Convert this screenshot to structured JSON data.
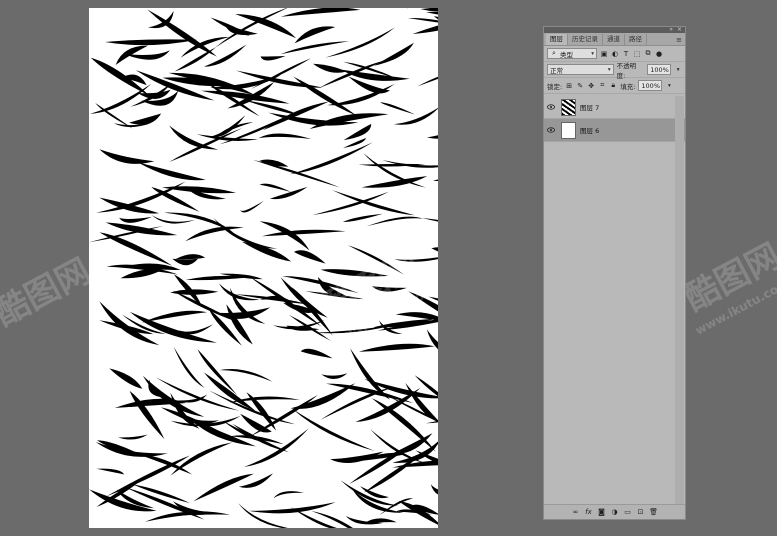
{
  "canvas": {
    "watermark_text": "酷图网",
    "watermark_url": "www.ikutu.com"
  },
  "panel": {
    "tabs": [
      {
        "label": "图层",
        "active": true
      },
      {
        "label": "历史记录",
        "active": false
      },
      {
        "label": "通道",
        "active": false
      },
      {
        "label": "路径",
        "active": false
      }
    ],
    "filter": {
      "label": "类型"
    },
    "blend_mode": "正常",
    "opacity_label": "不透明度:",
    "opacity_value": "100%",
    "lock_label": "锁定:",
    "fill_label": "填充:",
    "fill_value": "100%",
    "layers": [
      {
        "name": "图层 7",
        "selected": false,
        "thumb": "pattern"
      },
      {
        "name": "图层 6",
        "selected": true,
        "thumb": "white"
      }
    ],
    "icons": {
      "eye": "eye-icon",
      "link": "link-icon",
      "fx": "fx-icon",
      "mask": "mask-icon",
      "adjust": "adjustment-icon",
      "group": "folder-icon",
      "new": "new-layer-icon",
      "trash": "trash-icon"
    }
  }
}
